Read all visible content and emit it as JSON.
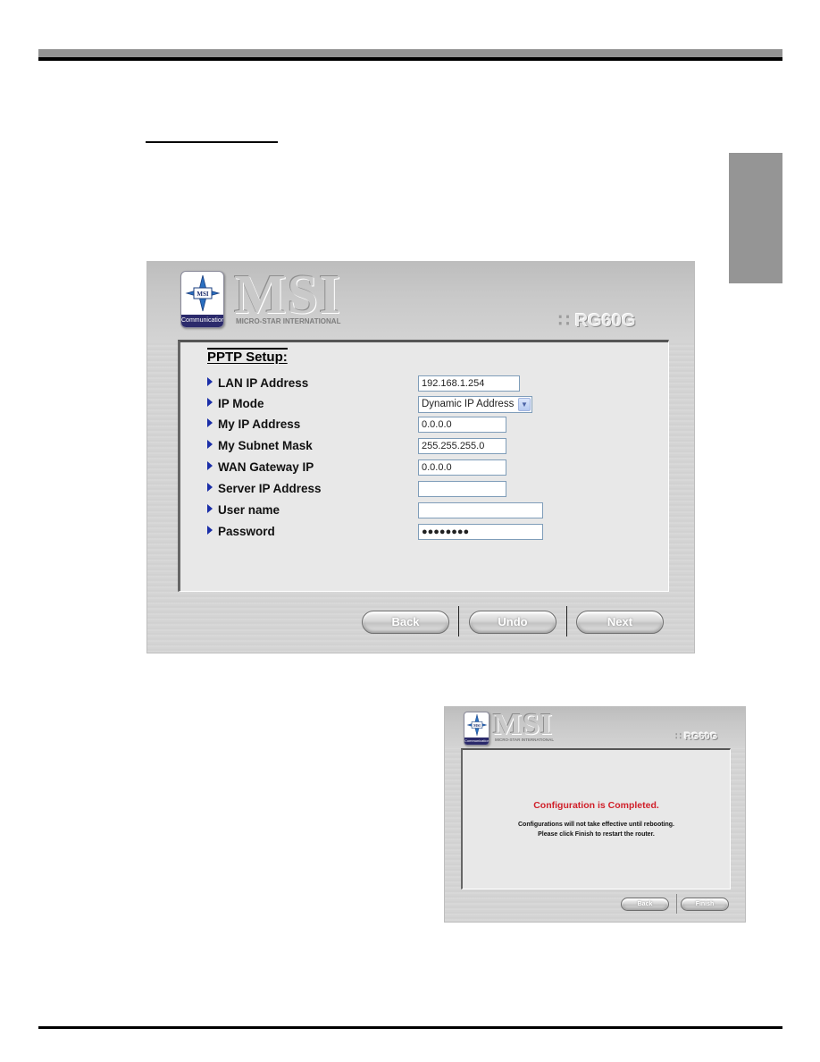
{
  "document": {
    "header_decoration": "gray-black-rule",
    "side_tab": "gray-thumb-tab"
  },
  "main_screenshot": {
    "brand": {
      "logo_badge_text": "MSI",
      "logo_band_text": "Communication",
      "wordmark": "MSI",
      "wordmark_subtitle": "MICRO-STAR INTERNATIONAL",
      "model_icon": "grid-icon",
      "model": "RG60G"
    },
    "section_title": "PPTP Setup:",
    "fields": [
      {
        "label": "LAN IP Address",
        "type": "text",
        "value": "192.168.1.254"
      },
      {
        "label": "IP Mode",
        "type": "select",
        "value": "Dynamic IP Address"
      },
      {
        "label": "My IP Address",
        "type": "text",
        "value": "0.0.0.0"
      },
      {
        "label": "My Subnet Mask",
        "type": "text",
        "value": "255.255.255.0"
      },
      {
        "label": "WAN Gateway IP",
        "type": "text",
        "value": "0.0.0.0"
      },
      {
        "label": "Server IP Address",
        "type": "text",
        "value": ""
      },
      {
        "label": "User name",
        "type": "text",
        "value": ""
      },
      {
        "label": "Password",
        "type": "password",
        "value": "●●●●●●●●"
      }
    ],
    "buttons": {
      "back": "Back",
      "undo": "Undo",
      "next": "Next"
    }
  },
  "completion_screenshot": {
    "brand": {
      "logo_badge_text": "MSI",
      "logo_band_text": "Communication",
      "wordmark": "MSI",
      "wordmark_subtitle": "MICRO-STAR INTERNATIONAL",
      "model": "RG60G"
    },
    "title": "Configuration is Completed.",
    "message_line1": "Configurations will not take effective until rebooting.",
    "message_line2": "Please click Finish to restart the router.",
    "title_color": "#d0202a",
    "buttons": {
      "back": "Back",
      "finish": "Finish"
    }
  }
}
